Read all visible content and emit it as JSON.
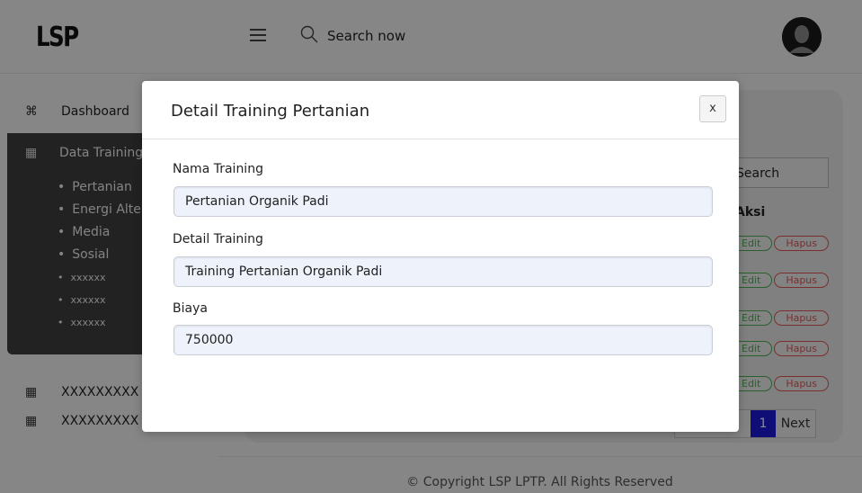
{
  "header": {
    "logo": "LSP",
    "search_placeholder": "Search now"
  },
  "sidebar": {
    "dashboard": "Dashboard",
    "data_training": "Data Training",
    "sub_items": [
      "Pertanian",
      "Energi Alternatif",
      "Media",
      "Sosial",
      "xxxxxx",
      "xxxxxx",
      "xxxxxx"
    ],
    "other_items": [
      "XXXXXXXXX",
      "XXXXXXXXX"
    ]
  },
  "table": {
    "search_label": "Search",
    "aksi_header": "Aksi",
    "edit_label": "Edit",
    "delete_label": "Hapus",
    "active_page": "1",
    "next_label": "Next"
  },
  "footer": {
    "copyright": "© Copyright LSP LPTP. All Rights Reserved"
  },
  "modal": {
    "title": "Detail Training Pertanian",
    "close_label": "x",
    "fields": {
      "nama_label": "Nama Training",
      "nama_value": "Pertanian Organik Padi",
      "detail_label": "Detail Training",
      "detail_value": "Training Pertanian Organik Padi",
      "biaya_label": "Biaya",
      "biaya_value": "750000"
    }
  },
  "colors": {
    "overlay": "rgba(0,0,0,0.45)",
    "sidebar_active_bg": "#3f3f3f",
    "edit": "#4caf50",
    "delete": "#e05555",
    "pager_active": "#1a1ad8",
    "input_bg": "#eef3fb"
  },
  "icons": {
    "menu": "hamburger-icon",
    "search": "search-icon",
    "user": "user-avatar-icon",
    "dashboard": "command-icon",
    "grid": "grid-icon"
  }
}
